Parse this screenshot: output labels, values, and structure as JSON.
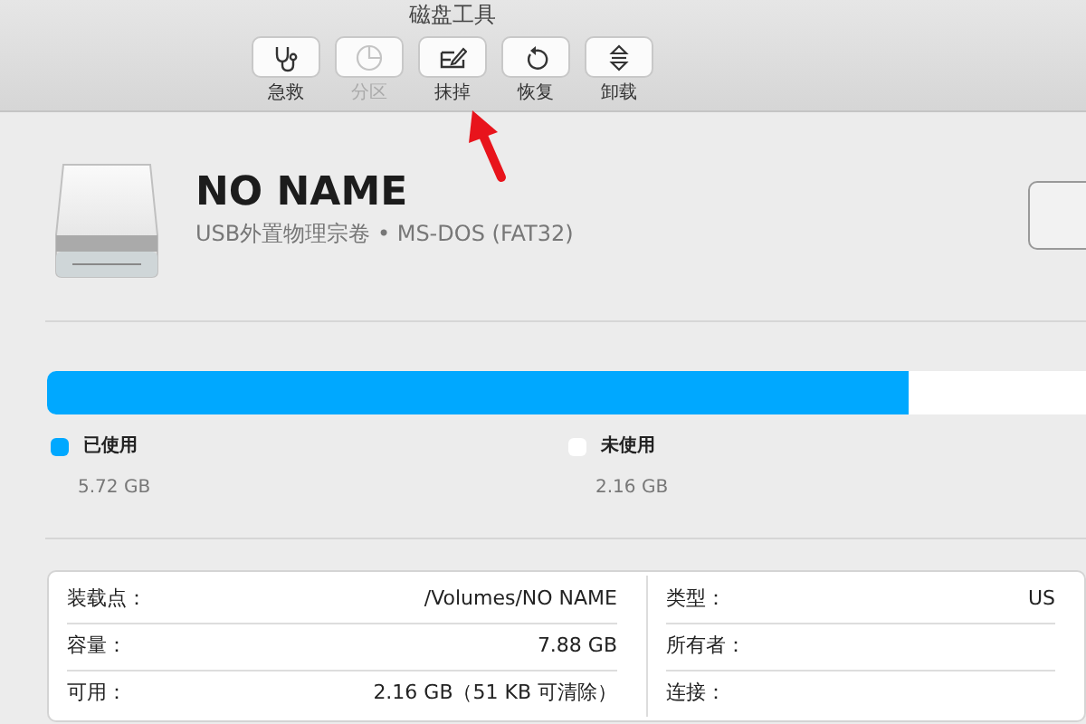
{
  "window": {
    "title": "磁盘工具"
  },
  "toolbar": [
    {
      "kind": "stethoscope",
      "label": "急救",
      "disabled": false
    },
    {
      "kind": "pie",
      "label": "分区",
      "disabled": true
    },
    {
      "kind": "erase",
      "label": "抹掉",
      "disabled": false
    },
    {
      "kind": "restore",
      "label": "恢复",
      "disabled": false
    },
    {
      "kind": "unmount",
      "label": "卸载",
      "disabled": false
    }
  ],
  "volume": {
    "name": "NO NAME",
    "description": "USB外置物理宗卷 • MS-DOS (FAT32)"
  },
  "usage": {
    "level": 0.83,
    "legend": [
      {
        "label": "已使用",
        "value": "5.72 GB",
        "color": "#00a8ff"
      },
      {
        "label": "未使用",
        "value": "2.16 GB",
        "color": "#ffffff"
      }
    ]
  },
  "info": {
    "left": [
      {
        "label": "装载点：",
        "value": "/Volumes/NO NAME"
      },
      {
        "label": "容量：",
        "value": "7.88 GB"
      },
      {
        "label": "可用：",
        "value": "2.16 GB（51 KB 可清除）"
      }
    ],
    "right": [
      {
        "label": "类型：",
        "value": "US"
      },
      {
        "label": "所有者："
      },
      {
        "label": "连接："
      }
    ]
  }
}
